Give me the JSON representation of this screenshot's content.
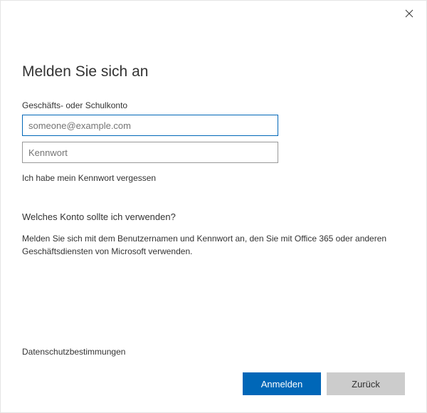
{
  "title": "Melden Sie sich an",
  "account_label": "Geschäfts- oder Schulkonto",
  "email_input": {
    "value": "",
    "placeholder": "someone@example.com"
  },
  "password_input": {
    "value": "",
    "placeholder": "Kennwort"
  },
  "forgot_password": "Ich habe mein Kennwort vergessen",
  "which_account_question": "Welches Konto sollte ich verwenden?",
  "help_text": "Melden Sie sich mit dem Benutzernamen und Kennwort an, den Sie mit Office 365 oder anderen Geschäftsdiensten von Microsoft verwenden.",
  "privacy_link": "Datenschutzbestimmungen",
  "buttons": {
    "signin": "Anmelden",
    "back": "Zurück"
  }
}
